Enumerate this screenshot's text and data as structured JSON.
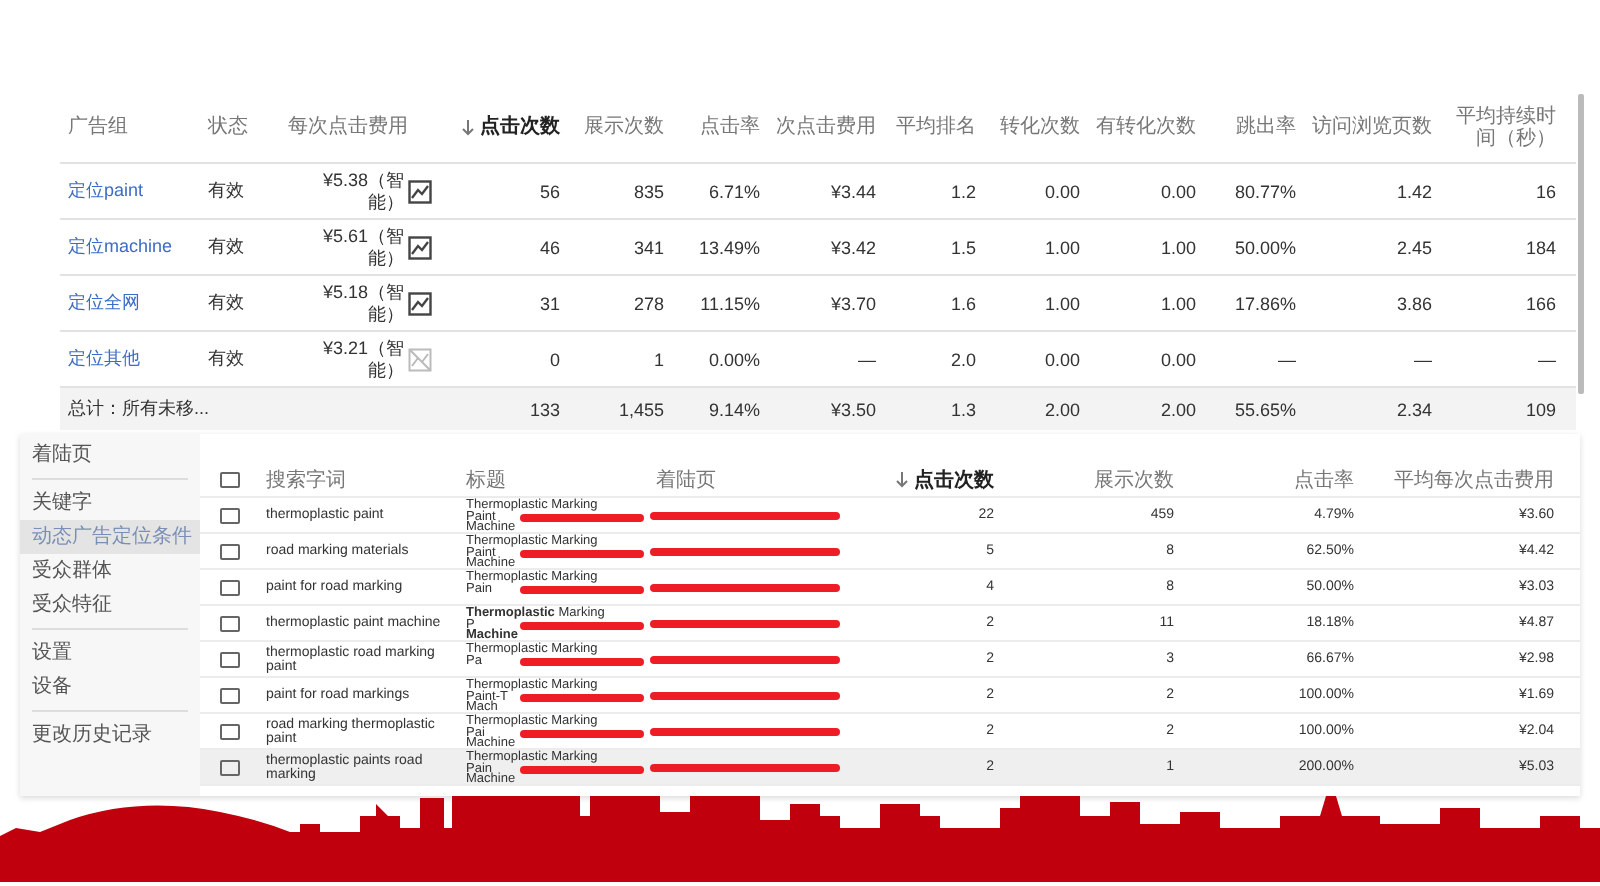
{
  "ad_groups_table": {
    "columns": [
      {
        "label": "广告组",
        "sorted": false
      },
      {
        "label": "状态",
        "sorted": false
      },
      {
        "label": "每次点击费用",
        "sorted": false
      },
      {
        "label": "点击次数",
        "sorted": true
      },
      {
        "label": "展示次数",
        "sorted": false
      },
      {
        "label": "点击率",
        "sorted": false
      },
      {
        "label": "次点击费用",
        "sorted": false
      },
      {
        "label": "平均排名",
        "sorted": false
      },
      {
        "label": "转化次数",
        "sorted": false
      },
      {
        "label": "有转化次数",
        "sorted": false
      },
      {
        "label": "跳出率",
        "sorted": false
      },
      {
        "label": "访问浏览页数",
        "sorted": false
      },
      {
        "label": "平均持续时间（秒）",
        "sorted": false
      }
    ],
    "rows": [
      {
        "bid_chart_active": true,
        "cells": [
          "定位paint",
          "有效",
          "¥5.38（智能）",
          "56",
          "835",
          "6.71%",
          "¥3.44",
          "1.2",
          "0.00",
          "0.00",
          "80.77%",
          "1.42",
          "16"
        ]
      },
      {
        "bid_chart_active": true,
        "cells": [
          "定位machine",
          "有效",
          "¥5.61（智能）",
          "46",
          "341",
          "13.49%",
          "¥3.42",
          "1.5",
          "1.00",
          "1.00",
          "50.00%",
          "2.45",
          "184"
        ]
      },
      {
        "bid_chart_active": true,
        "cells": [
          "定位全网",
          "有效",
          "¥5.18（智能）",
          "31",
          "278",
          "11.15%",
          "¥3.70",
          "1.6",
          "1.00",
          "1.00",
          "17.86%",
          "3.86",
          "166"
        ]
      },
      {
        "bid_chart_active": false,
        "cells": [
          "定位其他",
          "有效",
          "¥3.21（智能）",
          "0",
          "1",
          "0.00%",
          "—",
          "2.0",
          "0.00",
          "0.00",
          "—",
          "—",
          "—"
        ]
      }
    ],
    "total": {
      "cells": [
        "总计：所有未移...",
        "",
        "",
        "133",
        "1,455",
        "9.14%",
        "¥3.50",
        "1.3",
        "2.00",
        "2.00",
        "55.65%",
        "2.34",
        "109"
      ]
    }
  },
  "sidebar": {
    "groups": [
      {
        "items": [
          {
            "label": "着陆页",
            "selected": false
          }
        ]
      },
      {
        "items": [
          {
            "label": "关键字",
            "selected": false
          },
          {
            "label": "动态广告定位条件",
            "selected": true
          },
          {
            "label": "受众群体",
            "selected": false
          },
          {
            "label": "受众特征",
            "selected": false
          }
        ]
      },
      {
        "items": [
          {
            "label": "设置",
            "selected": false
          },
          {
            "label": "设备",
            "selected": false
          }
        ]
      },
      {
        "items": [
          {
            "label": "更改历史记录",
            "selected": false
          }
        ]
      }
    ]
  },
  "search_terms_table": {
    "select_all_checked": false,
    "columns": [
      {
        "label": "搜索字词",
        "sorted": false
      },
      {
        "label": "标题",
        "sorted": false
      },
      {
        "label": "着陆页",
        "sorted": false
      },
      {
        "label": "点击次数",
        "sorted": true
      },
      {
        "label": "展示次数",
        "sorted": false
      },
      {
        "label": "点击率",
        "sorted": false
      },
      {
        "label": "平均每次点击费用",
        "sorted": false
      }
    ],
    "rows": [
      {
        "checked": false,
        "selected": false,
        "redacted": true,
        "cells": [
          "thermoplastic paint",
          "Thermoplastic Marking\nPaint\nMachine",
          "",
          "22",
          "459",
          "4.79%",
          "¥3.60"
        ]
      },
      {
        "checked": false,
        "selected": false,
        "redacted": true,
        "cells": [
          "road marking materials",
          "Thermoplastic Marking\nPaint\nMachine",
          "",
          "5",
          "8",
          "62.50%",
          "¥4.42"
        ]
      },
      {
        "checked": false,
        "selected": false,
        "redacted": true,
        "cells": [
          "paint for road marking",
          "Thermoplastic Marking\nPain",
          "",
          "4",
          "8",
          "50.00%",
          "¥3.03"
        ]
      },
      {
        "checked": false,
        "selected": false,
        "redacted": true,
        "cells": [
          "thermoplastic paint machine",
          "**Thermoplastic** Marking\nP\n**Machine**",
          "",
          "2",
          "11",
          "18.18%",
          "¥4.87"
        ]
      },
      {
        "checked": false,
        "selected": false,
        "redacted": true,
        "cells": [
          "thermoplastic road marking paint",
          "Thermoplastic Marking\nPa",
          "",
          "2",
          "3",
          "66.67%",
          "¥2.98"
        ]
      },
      {
        "checked": false,
        "selected": false,
        "redacted": true,
        "cells": [
          "paint for road markings",
          "Thermoplastic Marking\nPaint-T\nMach",
          "",
          "2",
          "2",
          "100.00%",
          "¥1.69"
        ]
      },
      {
        "checked": false,
        "selected": false,
        "redacted": true,
        "cells": [
          "road marking thermoplastic paint",
          "Thermoplastic Marking\nPai\nMachine",
          "",
          "2",
          "2",
          "100.00%",
          "¥2.04"
        ]
      },
      {
        "checked": false,
        "selected": true,
        "redacted": true,
        "cells": [
          "thermoplastic paints road marking",
          "Thermoplastic Marking\nPain\nMachine",
          "",
          "2",
          "1",
          "200.00%",
          "¥5.03"
        ]
      }
    ]
  }
}
